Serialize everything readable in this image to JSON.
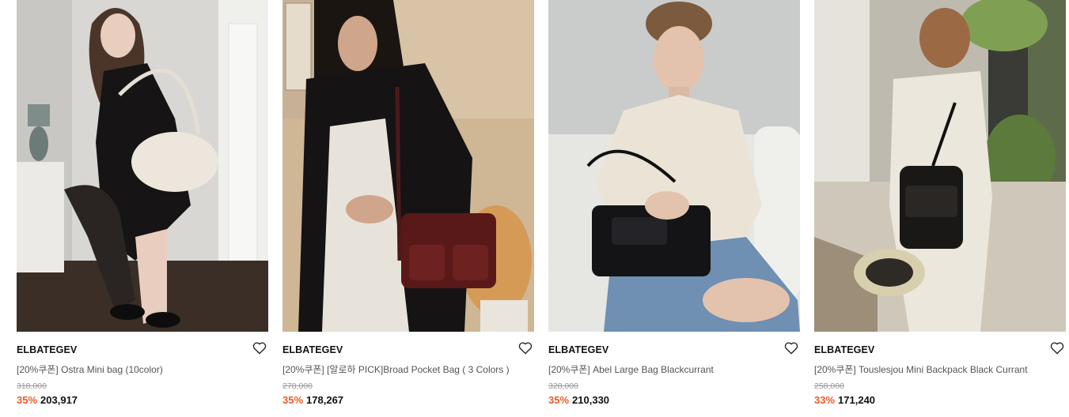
{
  "products": [
    {
      "brand": "ELBATEGEV",
      "name": "[20%쿠폰] Ostra Mini bag (10color)",
      "original_price": "318,000",
      "discount": "35%",
      "sale_price": "203,917",
      "image_alt": "model-with-cream-hobo-bag"
    },
    {
      "brand": "ELBATEGEV",
      "name": "[20%쿠폰] [알로하 PICK]Broad Pocket Bag ( 3 Colors )",
      "original_price": "278,000",
      "discount": "35%",
      "sale_price": "178,267",
      "image_alt": "model-with-burgundy-pocket-bag"
    },
    {
      "brand": "ELBATEGEV",
      "name": "[20%쿠폰] Abel Large Bag Blackcurrant",
      "original_price": "328,000",
      "discount": "35%",
      "sale_price": "210,330",
      "image_alt": "model-with-black-handbag"
    },
    {
      "brand": "ELBATEGEV",
      "name": "[20%쿠폰] Touslesjou Mini Backpack Black Currant",
      "original_price": "258,000",
      "discount": "33%",
      "sale_price": "171,240",
      "image_alt": "model-with-black-mini-backpack"
    }
  ],
  "colors": {
    "discount": "#ef5a25",
    "original_price": "#999999",
    "product_name": "#555555",
    "brand": "#111111"
  },
  "icons": {
    "wishlist": "heart-outline-icon"
  }
}
